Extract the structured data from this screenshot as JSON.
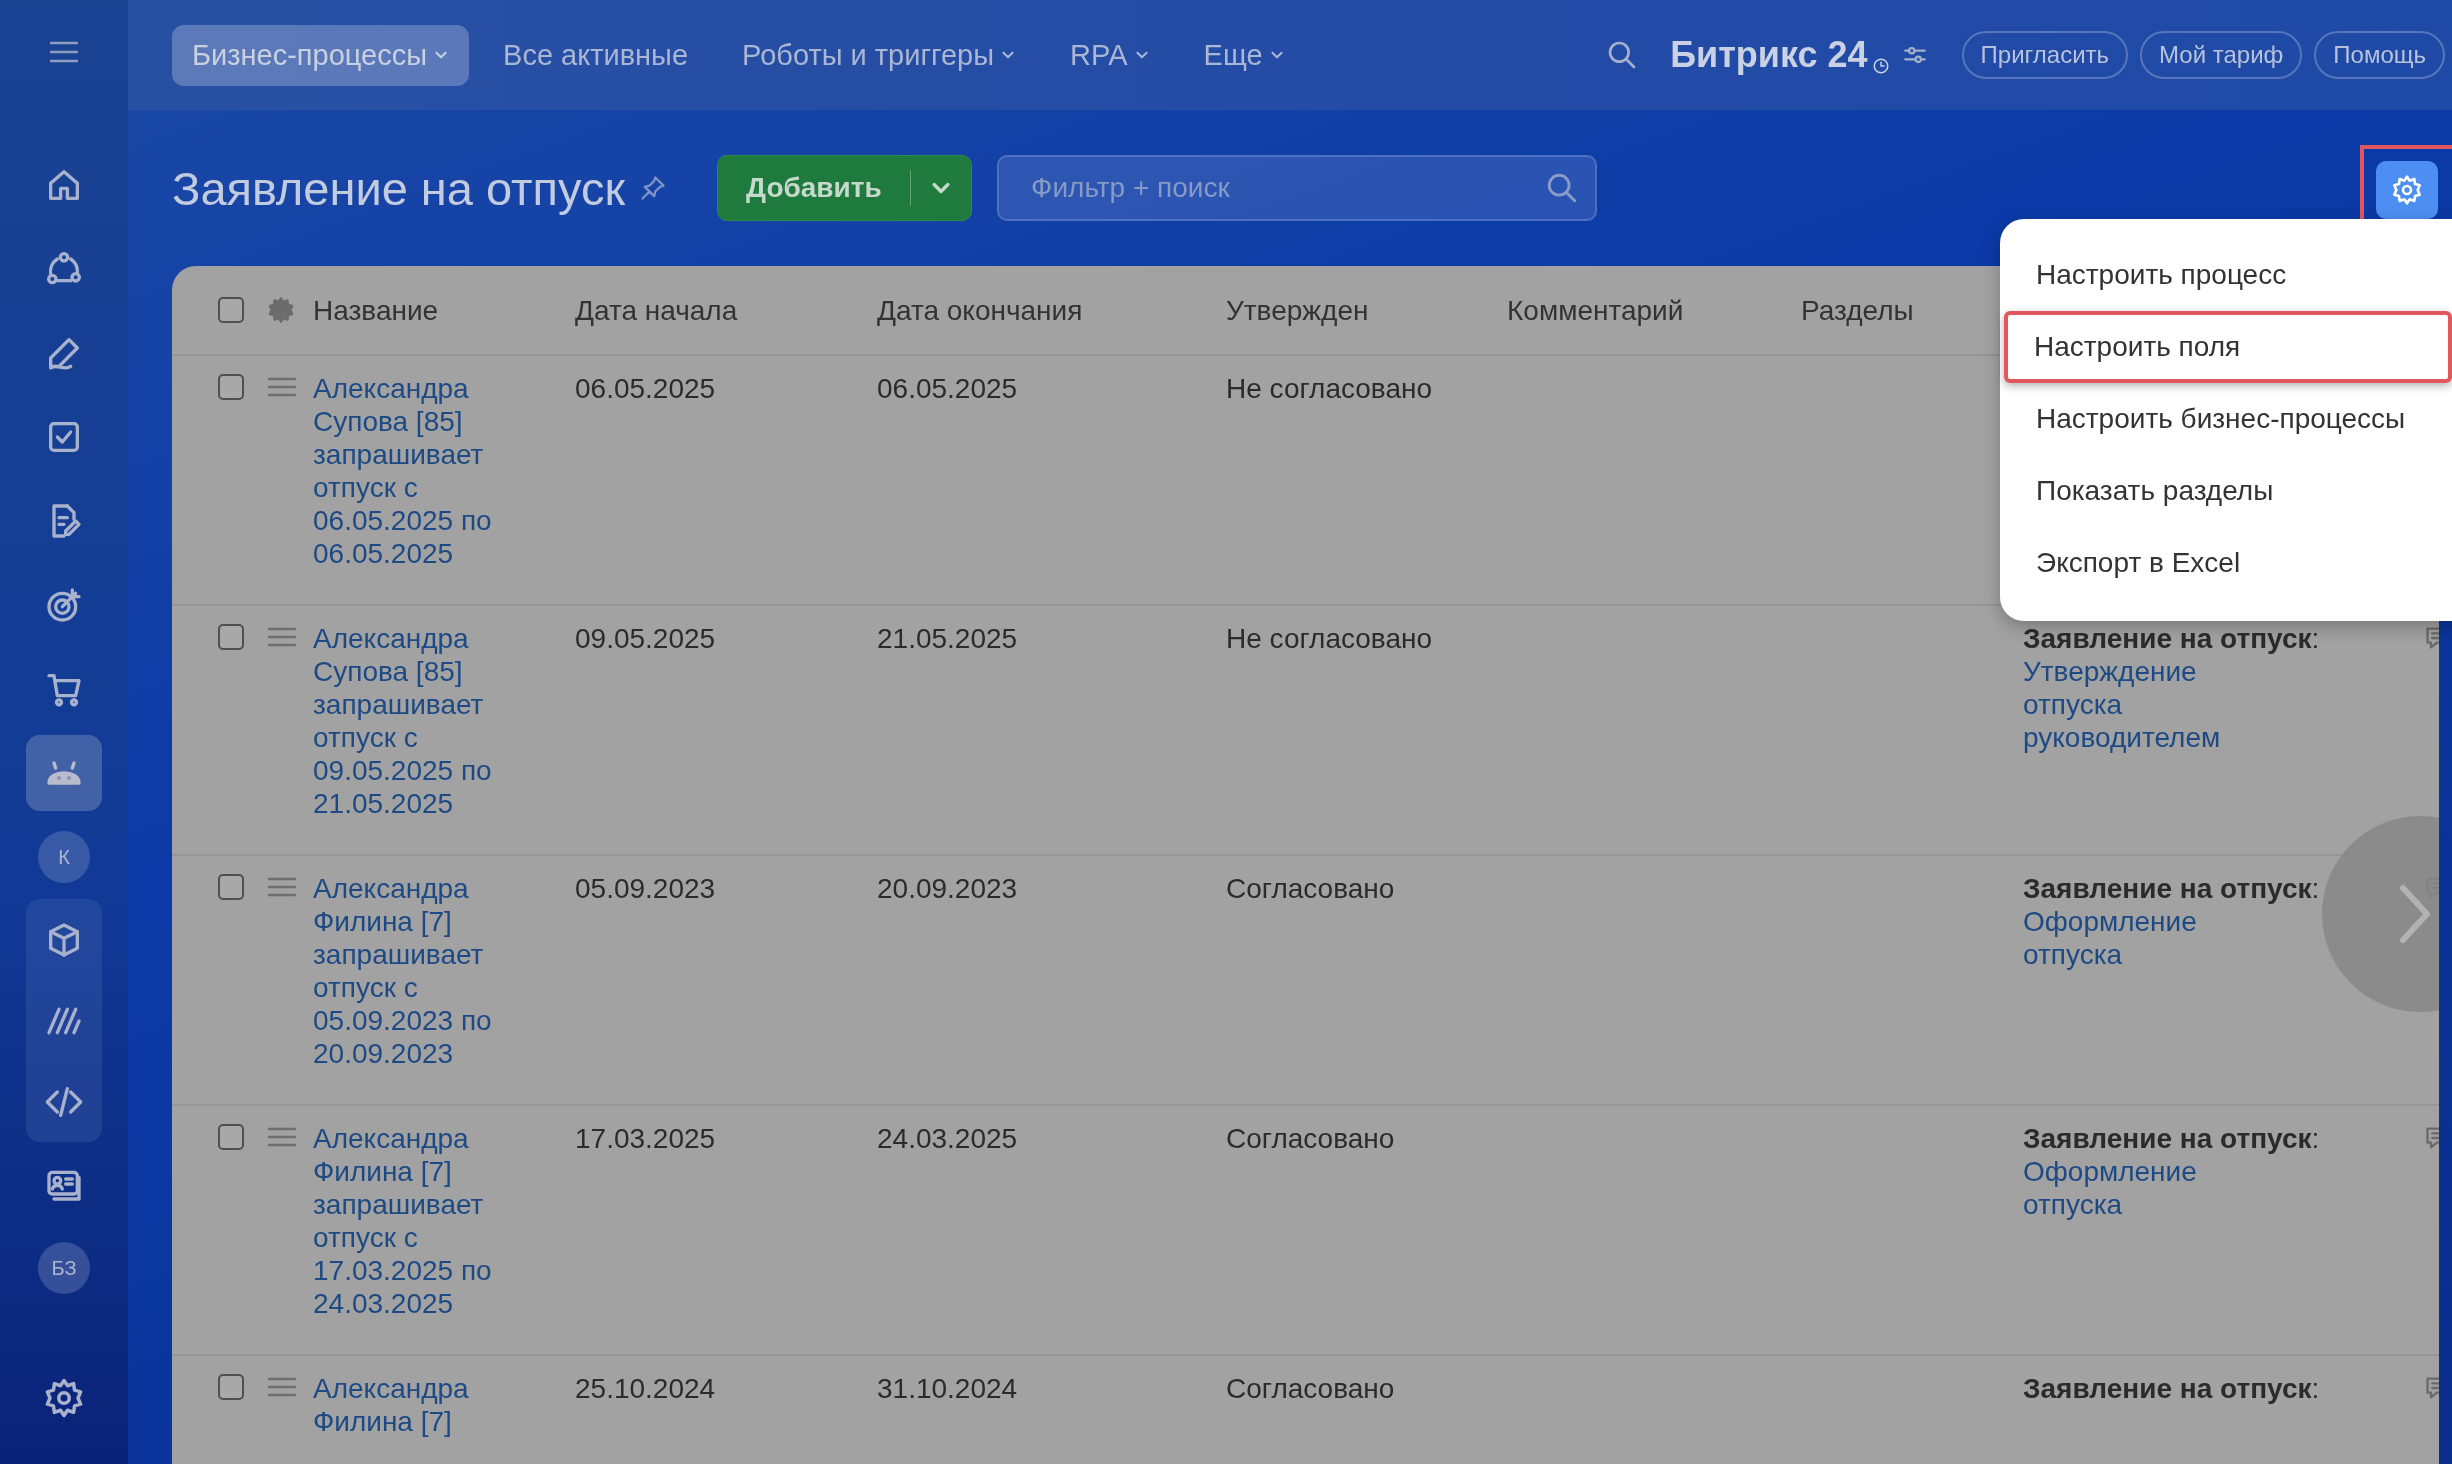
{
  "sidebar": {
    "items": [
      {
        "kind": "icon",
        "selected": false
      },
      {
        "kind": "icon",
        "selected": false
      },
      {
        "kind": "icon",
        "selected": false
      },
      {
        "kind": "icon",
        "selected": false
      },
      {
        "kind": "icon",
        "selected": false
      },
      {
        "kind": "icon",
        "selected": false
      },
      {
        "kind": "icon",
        "selected": false
      },
      {
        "kind": "icon",
        "selected": true
      },
      {
        "kind": "avatar",
        "label": "К"
      },
      {
        "kind": "group",
        "items": [
          {
            "kind": "icon",
            "selected": false
          },
          {
            "kind": "icon",
            "selected": false
          },
          {
            "kind": "icon",
            "selected": false
          }
        ]
      },
      {
        "kind": "icon",
        "selected": false
      },
      {
        "kind": "avatar",
        "label": "БЗ"
      }
    ]
  },
  "top_nav": {
    "tabs": [
      {
        "label": "Бизнес-процессы",
        "selected": true,
        "dropdown": true
      },
      {
        "label": "Все активные",
        "selected": false,
        "dropdown": false
      },
      {
        "label": "Роботы и триггеры",
        "selected": false,
        "dropdown": true
      },
      {
        "label": "RPA",
        "selected": false,
        "dropdown": true
      },
      {
        "label": "Еще",
        "selected": false,
        "dropdown": true
      }
    ],
    "logo": "Битрикс 24",
    "buttons": [
      "Пригласить",
      "Мой тариф",
      "Помощь"
    ]
  },
  "page": {
    "title": "Заявление на отпуск",
    "add_button": "Добавить",
    "filter": {
      "placeholder": "Фильтр + поиск"
    },
    "settings_button": {
      "highlighted": true
    }
  },
  "table": {
    "select_all_checked": false,
    "columns": [
      "Название",
      "Дата начала",
      "Дата окончания",
      "Утвержден",
      "Комментарий",
      "Разделы"
    ],
    "rows": [
      {
        "checked": false,
        "name": "Александра Супова [85] запрашивает отпуск с 06.05.2025 по 06.05.2025",
        "start": "06.05.2025",
        "end": "06.05.2025",
        "approved": "Не согласовано"
      },
      {
        "checked": false,
        "name": "Александра Супова [85] запрашивает отпуск с 09.05.2025 по 21.05.2025",
        "start": "09.05.2025",
        "end": "21.05.2025",
        "approved": "Не согласовано",
        "process_label": "**Заявление на отпуск**:",
        "process_link": "Утверждение отпуска руководителем"
      },
      {
        "checked": false,
        "name": "Александра Филина [7] запрашивает отпуск с 05.09.2023 по 20.09.2023",
        "start": "05.09.2023",
        "end": "20.09.2023",
        "approved": "Согласовано",
        "process_label": "**Заявление на отпуск**:",
        "process_link": "Оформление отпуска"
      },
      {
        "checked": false,
        "name": "Александра Филина [7] запрашивает отпуск с 17.03.2025 по 24.03.2025",
        "start": "17.03.2025",
        "end": "24.03.2025",
        "approved": "Согласовано",
        "process_label": "**Заявление на отпуск**:",
        "process_link": "Оформление отпуска"
      },
      {
        "checked": false,
        "name": "Александра Филина [7]",
        "start": "25.10.2024",
        "end": "31.10.2024",
        "approved": "Согласовано",
        "process_label": "**Заявление на отпуск**:"
      }
    ]
  },
  "settings_menu": {
    "items": [
      {
        "label": "Настроить процесс",
        "highlighted": false
      },
      {
        "label": "Настроить поля",
        "highlighted": true
      },
      {
        "label": "Настроить бизнес-процессы",
        "highlighted": false
      },
      {
        "label": "Показать разделы",
        "highlighted": false
      },
      {
        "label": "Экспорт в Excel",
        "highlighted": false
      }
    ]
  }
}
